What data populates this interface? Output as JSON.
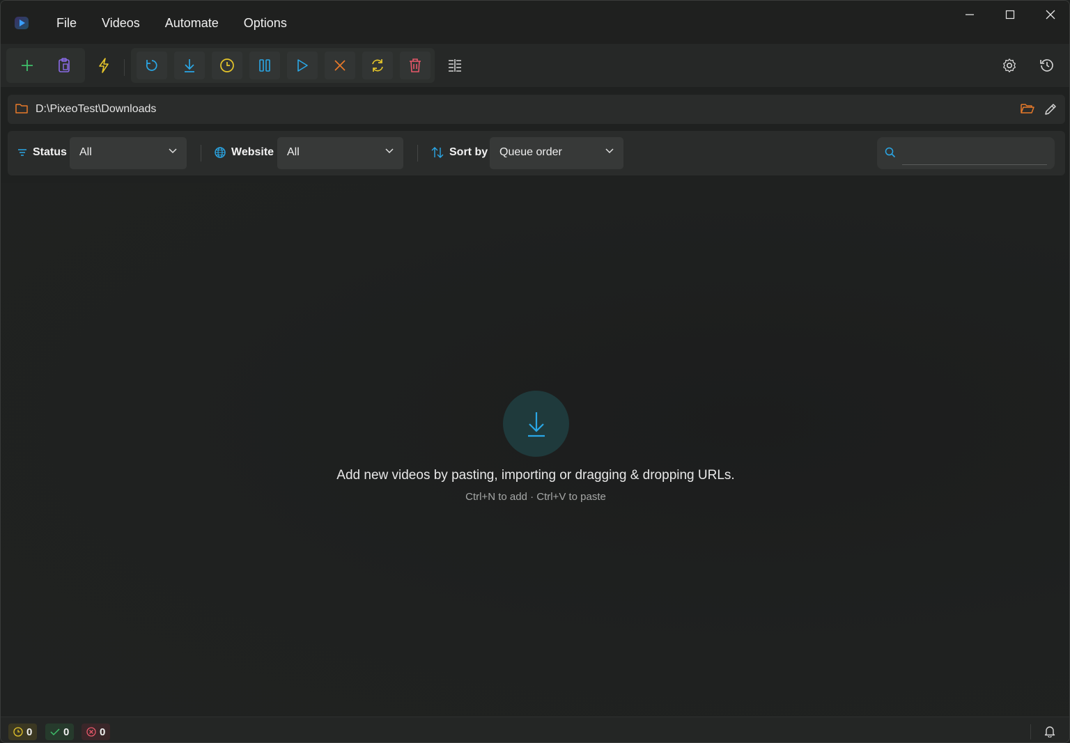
{
  "menu": [
    "File",
    "Videos",
    "Automate",
    "Options"
  ],
  "toolbar": {
    "buttons": [
      "add-icon",
      "paste-clipboard-icon",
      "lightning-icon",
      "refresh-icon",
      "download-icon",
      "schedule-clock-icon",
      "pause-icon",
      "play-icon",
      "cancel-icon",
      "retry-icon",
      "delete-icon",
      "columns-icon"
    ],
    "right": [
      "settings-icon",
      "history-icon"
    ]
  },
  "path": {
    "value": "D:\\PixeoTest\\Downloads"
  },
  "filters": {
    "status": {
      "label": "Status",
      "value": "All"
    },
    "website": {
      "label": "Website",
      "value": "All"
    },
    "sort": {
      "label": "Sort by",
      "value": "Queue order"
    },
    "search": {
      "value": ""
    }
  },
  "empty_state": {
    "title": "Add new videos by pasting, importing or dragging & dropping URLs.",
    "hint": "Ctrl+N to add · Ctrl+V to paste"
  },
  "status_bar": {
    "queued": "0",
    "completed": "0",
    "failed": "0"
  },
  "colors": {
    "accent_blue": "#2aa7e6",
    "green": "#3fbf6a",
    "purple": "#8a6be8",
    "yellow": "#e6c62a",
    "orange": "#e87a2a",
    "red": "#e8586a"
  }
}
